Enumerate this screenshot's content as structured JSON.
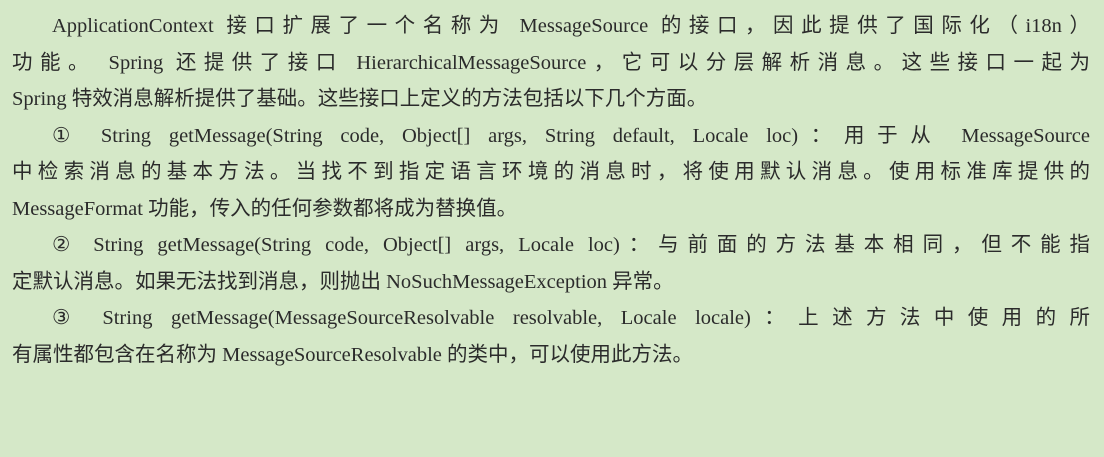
{
  "document": {
    "paragraphs": [
      {
        "id": "intro",
        "lines": [
          "ApplicationContext 接口扩展了一个名称为 MessageSource 的接口，因此提供了国际化（i18n）",
          "功能。 Spring 还提供了接口 HierarchicalMessageSource，它可以分层解析消息。这些接口一起为",
          "Spring 特效消息解析提供了基础。这些接口上定义的方法包括以下几个方面。"
        ]
      },
      {
        "id": "method-1",
        "lines": [
          "① String getMessage(String code, Object[] args, String default, Locale loc)：用于从 MessageSource",
          "中检索消息的基本方法。当找不到指定语言环境的消息时，将使用默认消息。使用标准库提供的",
          "MessageFormat 功能，传入的任何参数都将成为替换值。"
        ]
      },
      {
        "id": "method-2",
        "lines": [
          "② String getMessage(String code, Object[] args, Locale loc)：与前面的方法基本相同，但不能指",
          "定默认消息。如果无法找到消息，则抛出 NoSuchMessageException 异常。"
        ]
      },
      {
        "id": "method-3",
        "lines": [
          "③ String getMessage(MessageSourceResolvable resolvable, Locale locale)：上述方法中使用的所",
          "有属性都包含在名称为 MessageSourceResolvable 的类中，可以使用此方法。"
        ]
      }
    ]
  }
}
